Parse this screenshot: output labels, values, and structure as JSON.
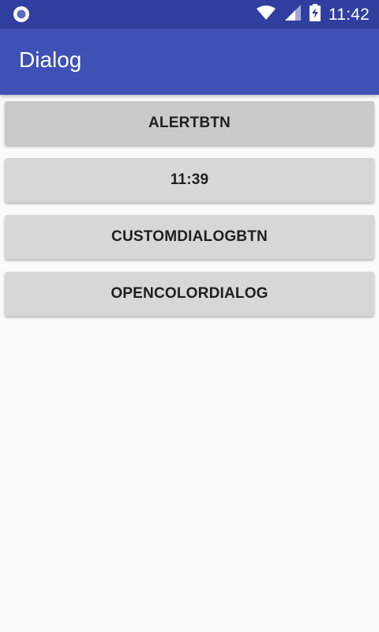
{
  "status_bar": {
    "time": "11:42",
    "icons": [
      "circle-notification-icon",
      "wifi-icon",
      "signal-icon",
      "battery-charging-icon"
    ]
  },
  "app_bar": {
    "title": "Dialog"
  },
  "buttons": [
    {
      "label": "ALERTBTN"
    },
    {
      "label": "11:39"
    },
    {
      "label": "CUSTOMDIALOGBTN"
    },
    {
      "label": "OPENCOLORDIALOG"
    }
  ],
  "colors": {
    "status_bar": "#303f9f",
    "app_bar": "#3f51b5",
    "background": "#fafafa",
    "button": "#d6d7d7",
    "button_pressed": "#c9cbca",
    "button_text": "#1f1f1f"
  }
}
